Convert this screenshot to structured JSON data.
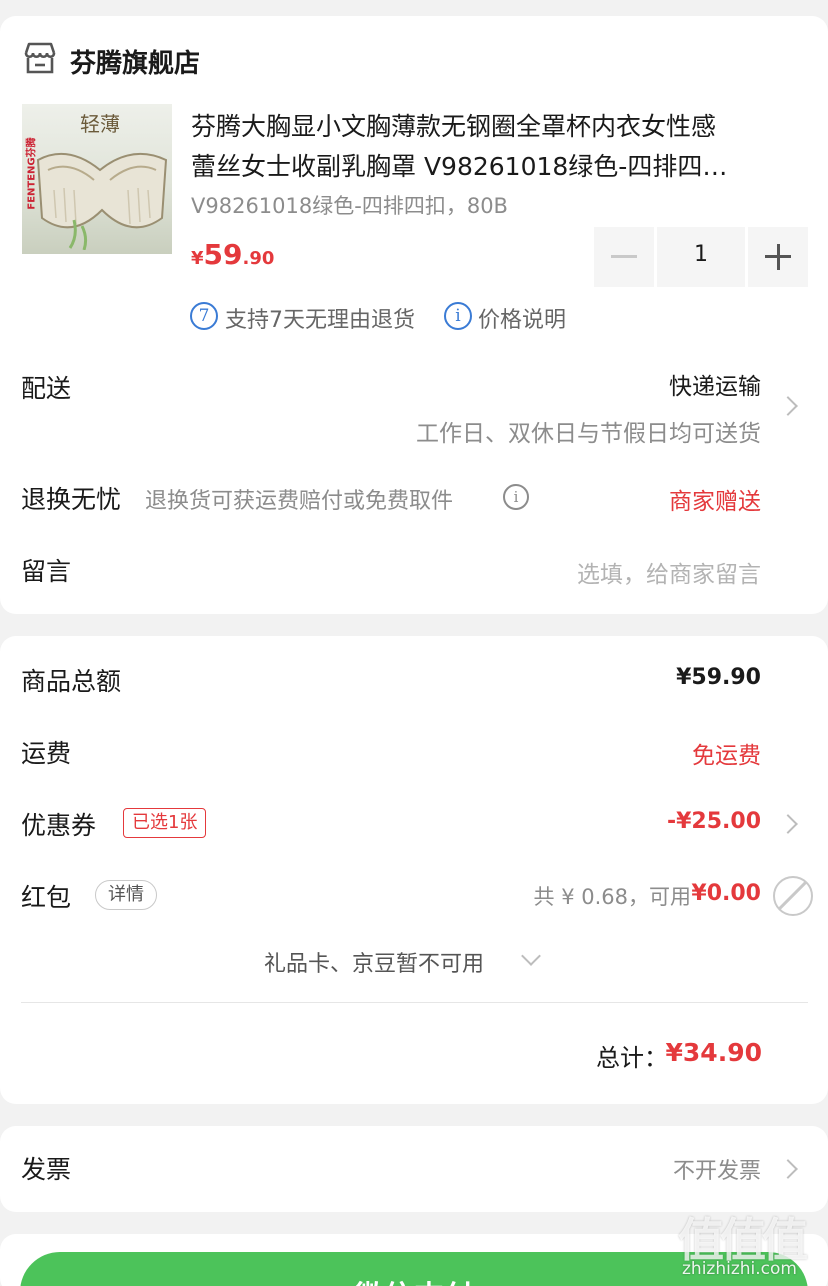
{
  "store": {
    "name": "芬腾旗舰店",
    "icon": "store-icon"
  },
  "product": {
    "thumb_brand": "FENTENG芬腾",
    "thumb_text": "轻薄",
    "title_line1": "芬腾大胸显小文胸薄款无钢圈全罩杯内衣女性感",
    "title_line2": "蕾丝女士收副乳胸罩 V98261018绿色-四排四…",
    "sku": "V98261018绿色-四排四扣，80B",
    "price_symbol": "¥",
    "price_int": "59",
    "price_dec": ".90",
    "quantity": "1",
    "minus": "−",
    "plus": "+",
    "return_badge": "7",
    "return_text": "支持7天无理由退货",
    "price_info_icon": "i",
    "price_info_text": "价格说明"
  },
  "delivery": {
    "label": "配送",
    "method": "快递运输",
    "note": "工作日、双休日与节假日均可送货"
  },
  "returns": {
    "label": "退换无忧",
    "desc": "退换货可获运费赔付或免费取件",
    "value": "商家赠送",
    "info_icon": "i"
  },
  "message": {
    "label": "留言",
    "placeholder": "选填，给商家留言"
  },
  "summary": {
    "goods_total_label": "商品总额",
    "goods_total_value": "¥59.90",
    "shipping_label": "运费",
    "shipping_value": "免运费",
    "coupon_label": "优惠券",
    "coupon_badge": "已选1张",
    "coupon_value": "-¥25.00",
    "redpacket_label": "红包",
    "redpacket_detail": "详情",
    "redpacket_info": "共 ¥ 0.68，可用",
    "redpacket_value": "¥0.00",
    "giftcard_text": "礼品卡、京豆暂不可用",
    "total_label": "总计：",
    "total_value": "¥34.90"
  },
  "invoice": {
    "label": "发票",
    "value": "不开发票"
  },
  "pay_button": {
    "label": "微信支付"
  },
  "watermark": {
    "text": "zhizhizhi.com",
    "logo": "值值值"
  },
  "colors": {
    "accent_red": "#e4393c",
    "pay_green": "#4cc35a",
    "info_blue": "#3a7bd5"
  }
}
